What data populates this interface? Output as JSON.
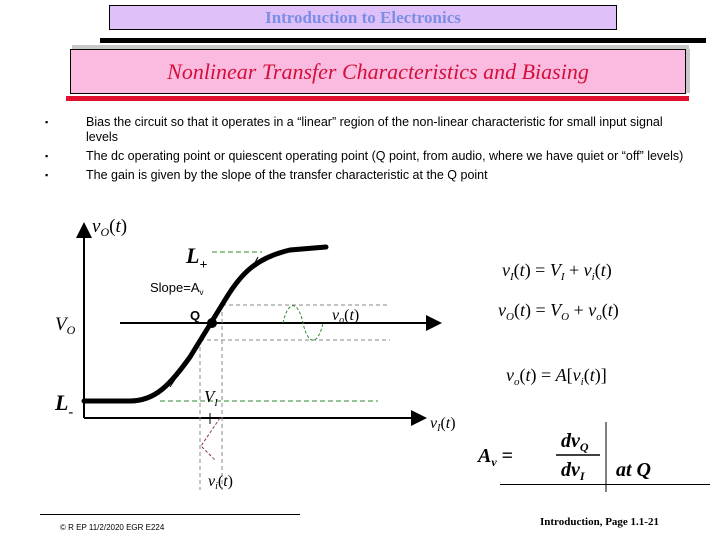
{
  "header": {
    "course_title": "Introduction to Electronics",
    "slide_title": "Nonlinear Transfer Characteristics and Biasing"
  },
  "bullets": [
    {
      "marker": "▪",
      "text": "Bias the circuit so that it operates in a “linear” region of the non-linear characteristic for small input signal levels"
    },
    {
      "marker": "▪",
      "text": "The dc operating point or quiescent operating point (Q point, from audio, where we have quiet or “off” levels)"
    },
    {
      "marker": "▪",
      "text": "The gain is given by the slope of the transfer characteristic at the Q point"
    }
  ],
  "diagram": {
    "y_axis_label": "v_O(t)",
    "x_axis_label": "v_I(t)",
    "vo_label": "V_O",
    "l_plus_label": "L+",
    "l_minus_label": "L-",
    "slope_label": "Slope=A",
    "slope_sub": "v",
    "q_label": "Q",
    "vi_dc_label": "V_I",
    "small_output_label": "v_o(t)",
    "small_input_label": "v_i(t)",
    "colors": {
      "curve": "#000000",
      "green_dashed": "#2e8b2e",
      "grey_dashed": "#8a8a8a",
      "input_wave": "#8b3a4a"
    }
  },
  "equations": {
    "eq1": {
      "lhs": "v",
      "lhs_sub": "I",
      "rhs1": "V",
      "rhs1_sub": "I",
      "rhs2": "v",
      "rhs2_sub": "i"
    },
    "eq2": {
      "lhs": "v",
      "lhs_sub": "O",
      "rhs1": "V",
      "rhs1_sub": "O",
      "rhs2": "v",
      "rhs2_sub": "o"
    },
    "eq3": {
      "lhs": "v",
      "lhs_sub": "o",
      "rhs": "A",
      "arg": "v",
      "arg_sub": "i"
    },
    "gain": {
      "lhs": "A",
      "lhs_sub": "v",
      "num": "dv",
      "num_sub": "Q",
      "den": "dv",
      "den_sub": "I",
      "eval": "at Q"
    }
  },
  "footer": {
    "left": "© R EP  11/2/2020  EGR E224",
    "right": "Introduction, Page 1.1-21"
  }
}
